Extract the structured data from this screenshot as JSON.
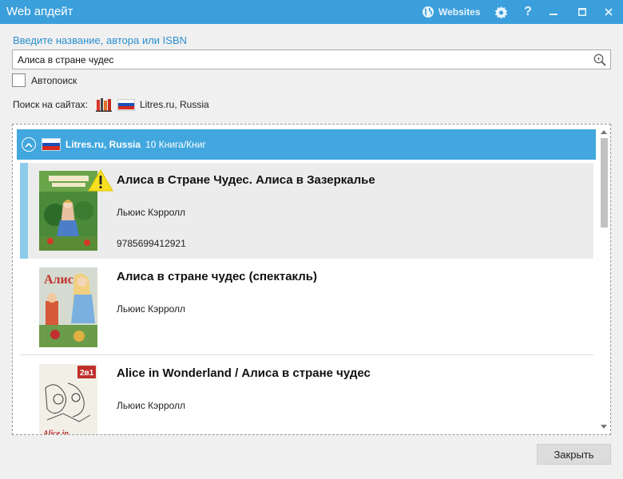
{
  "window": {
    "title": "Web апдейт",
    "websites_label": "Websites",
    "accent_color": "#3b9fdb"
  },
  "search": {
    "label": "Введите название, автора или ISBN",
    "value": "Алиса в стране чудес",
    "icon": "magnifier-icon"
  },
  "autosearch": {
    "label": "Автопоиск",
    "checked": false
  },
  "sites": {
    "label": "Поиск на сайтах:",
    "selected_site": "Litres.ru, Russia"
  },
  "results": {
    "group": {
      "name": "Litres.ru, Russia",
      "count_text": "10 Книга/Книг",
      "header_color": "#41a7de"
    },
    "items": [
      {
        "title": "Алиса в Стране Чудес. Алиса в Зазеркалье",
        "author": "Льюис Кэрролл",
        "isbn": "9785699412921",
        "selected": true,
        "warning": true
      },
      {
        "title": "Алиса в стране чудес (спектакль)",
        "author": "Льюис Кэрролл",
        "isbn": "",
        "selected": false,
        "warning": false
      },
      {
        "title": "Alice in Wonderland / Алиса в стране чудес",
        "author": "Льюис Кэрролл",
        "isbn": "",
        "selected": false,
        "warning": false
      }
    ]
  },
  "footer": {
    "close_label": "Закрыть"
  }
}
